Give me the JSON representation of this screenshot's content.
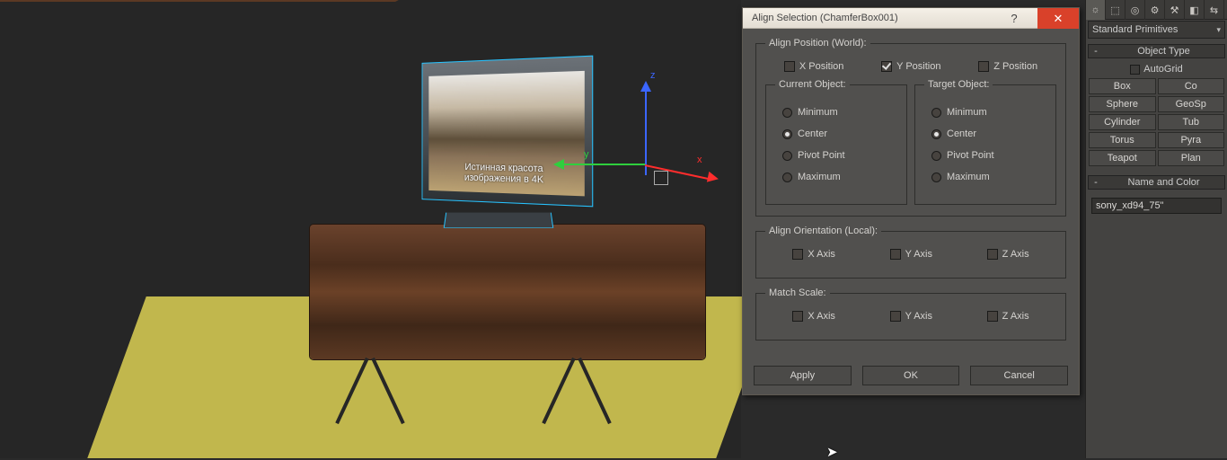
{
  "viewport": {
    "tv_caption_1": "Истинная красота",
    "tv_caption_2": "изображения в 4K",
    "axes": {
      "x": "x",
      "y": "y",
      "z": "z"
    }
  },
  "dialog": {
    "title": "Align Selection (ChamferBox001)",
    "help_label": "?",
    "close_label": "✕",
    "align_position": {
      "legend": "Align Position (World):",
      "x": "X Position",
      "y": "Y Position",
      "z": "Z Position",
      "y_checked": true,
      "current": {
        "legend": "Current Object:",
        "options": [
          "Minimum",
          "Center",
          "Pivot Point",
          "Maximum"
        ],
        "selected": "Center"
      },
      "target": {
        "legend": "Target Object:",
        "options": [
          "Minimum",
          "Center",
          "Pivot Point",
          "Maximum"
        ],
        "selected": "Center"
      }
    },
    "align_orientation": {
      "legend": "Align Orientation (Local):",
      "x": "X Axis",
      "y": "Y Axis",
      "z": "Z Axis"
    },
    "match_scale": {
      "legend": "Match Scale:",
      "x": "X Axis",
      "y": "Y Axis",
      "z": "Z Axis"
    },
    "buttons": {
      "apply": "Apply",
      "ok": "OK",
      "cancel": "Cancel"
    }
  },
  "panel": {
    "icons": [
      "☼",
      "⬚",
      "◎",
      "⚙",
      "⚒",
      "◧",
      "⇆"
    ],
    "dropdown": "Standard Primitives",
    "object_type": {
      "header": "Object Type",
      "autogrid": "AutoGrid",
      "buttons_left": [
        "Box",
        "Sphere",
        "Cylinder",
        "Torus",
        "Teapot"
      ],
      "buttons_right": [
        "Co",
        "GeoSp",
        "Tub",
        "Pyra",
        "Plan"
      ]
    },
    "name_color": {
      "header": "Name and Color",
      "value": "sony_xd94_75\""
    }
  }
}
